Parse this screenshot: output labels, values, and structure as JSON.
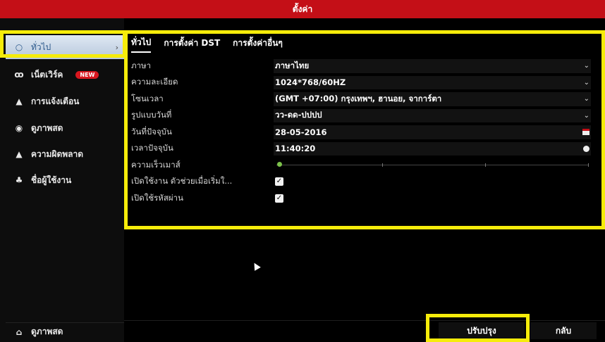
{
  "window": {
    "title": "ตั้งค่า"
  },
  "sidebar": {
    "items": [
      {
        "label": "ทั่วไป",
        "icon": "circle-icon",
        "glyph": "○"
      },
      {
        "label": "เน็ตเวิร์ค",
        "icon": "network-icon",
        "glyph": "ꝏ",
        "badge": "NEW"
      },
      {
        "label": "การแจ้งเตือน",
        "icon": "alarm-icon",
        "glyph": "▲"
      },
      {
        "label": "ดูภาพสด",
        "icon": "live-view-icon",
        "glyph": "◉"
      },
      {
        "label": "ความผิดพลาด",
        "icon": "warning-icon",
        "glyph": "▲"
      },
      {
        "label": "ชื่อผู้ใช้งาน",
        "icon": "users-icon",
        "glyph": "♣"
      }
    ],
    "bottom": {
      "label": "ดูภาพสด",
      "icon": "home-icon",
      "glyph": "⌂"
    }
  },
  "tabs": [
    {
      "label": "ทั่วไป"
    },
    {
      "label": "การตั้งค่า DST"
    },
    {
      "label": "การตั้งค่าอื่นๆ"
    }
  ],
  "settings": {
    "language": {
      "label": "ภาษา",
      "value": "ภาษาไทย"
    },
    "resolution": {
      "label": "ความละเอียด",
      "value": "1024*768/60HZ"
    },
    "timezone": {
      "label": "โซนเวลา",
      "value": "(GMT +07:00) กรุงเทพฯ, ฮานอย, จาการ์ตา"
    },
    "date_format": {
      "label": "รูปแบบวันที่",
      "value": "วว-ดด-ปปปป"
    },
    "date": {
      "label": "วันที่ปัจจุบัน",
      "value": "28-05-2016"
    },
    "time": {
      "label": "เวลาปัจจุบัน",
      "value": "11:40:20"
    },
    "mouse_speed": {
      "label": "ความเร็วเมาส์",
      "level": 0
    },
    "wizard": {
      "label": "เปิดใช้งาน ตัวช่วยเมื่อเริ่มใ...",
      "checked": true
    },
    "password": {
      "label": "เปิดใช้รหัสผ่าน",
      "checked": true
    }
  },
  "buttons": {
    "apply": "ปรับปรุง",
    "back": "กลับ"
  },
  "colors": {
    "title_bar": "#c40f17",
    "highlight": "#f6ec0a",
    "active_item": "#c9d8e9"
  }
}
